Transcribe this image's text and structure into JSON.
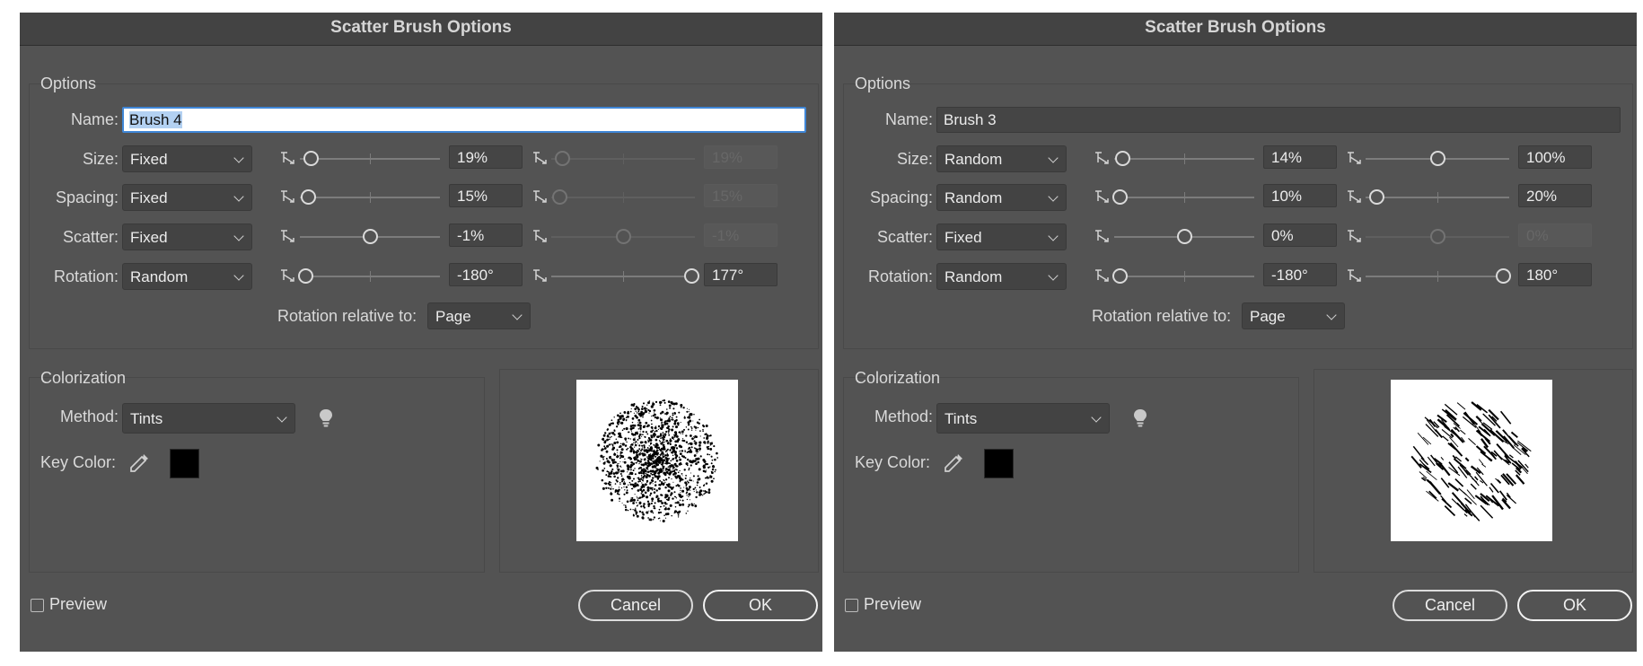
{
  "dialogs": [
    {
      "title": "Scatter Brush Options",
      "options": {
        "group_label": "Options",
        "name_label": "Name:",
        "name_value": "Brush 4",
        "rows": [
          {
            "label": "Size:",
            "method": "Fixed",
            "min_value": "19%",
            "max_value": "19%",
            "max_enabled": false,
            "min_position": 0.08,
            "max_position": 0.08
          },
          {
            "label": "Spacing:",
            "method": "Fixed",
            "min_value": "15%",
            "max_value": "15%",
            "max_enabled": false,
            "min_position": 0.06,
            "max_position": 0.06
          },
          {
            "label": "Scatter:",
            "method": "Fixed",
            "min_value": "-1%",
            "max_value": "-1%",
            "max_enabled": false,
            "min_position": 0.5,
            "max_position": 0.5
          },
          {
            "label": "Rotation:",
            "method": "Random",
            "min_value": "-180°",
            "max_value": "177°",
            "max_enabled": true,
            "min_position": 0.04,
            "max_position": 0.98
          }
        ],
        "rotation_relative_label": "Rotation relative to:",
        "rotation_relative_value": "Page"
      },
      "colorization": {
        "group_label": "Colorization",
        "method_label": "Method:",
        "method_value": "Tints",
        "key_color_label": "Key Color:",
        "key_color": "#000000"
      },
      "preview_label": "Preview",
      "cancel_label": "Cancel",
      "ok_label": "OK"
    },
    {
      "title": "Scatter Brush Options",
      "options": {
        "group_label": "Options",
        "name_label": "Name:",
        "name_value": "Brush 3",
        "rows": [
          {
            "label": "Size:",
            "method": "Random",
            "min_value": "14%",
            "max_value": "100%",
            "max_enabled": true,
            "min_position": 0.06,
            "max_position": 0.5
          },
          {
            "label": "Spacing:",
            "method": "Random",
            "min_value": "10%",
            "max_value": "20%",
            "max_enabled": true,
            "min_position": 0.04,
            "max_position": 0.08
          },
          {
            "label": "Scatter:",
            "method": "Fixed",
            "min_value": "0%",
            "max_value": "0%",
            "max_enabled": false,
            "min_position": 0.5,
            "max_position": 0.5
          },
          {
            "label": "Rotation:",
            "method": "Random",
            "min_value": "-180°",
            "max_value": "180°",
            "max_enabled": true,
            "min_position": 0.04,
            "max_position": 0.96
          }
        ],
        "rotation_relative_label": "Rotation relative to:",
        "rotation_relative_value": "Page"
      },
      "colorization": {
        "group_label": "Colorization",
        "method_label": "Method:",
        "method_value": "Tints",
        "key_color_label": "Key Color:",
        "key_color": "#000000"
      },
      "preview_label": "Preview",
      "cancel_label": "Cancel",
      "ok_label": "OK"
    }
  ],
  "colors": {
    "dialog_bg": "#535353",
    "titlebar_bg": "#434343",
    "focus_ring": "#3f86d6",
    "text": "#e6e6e6"
  }
}
